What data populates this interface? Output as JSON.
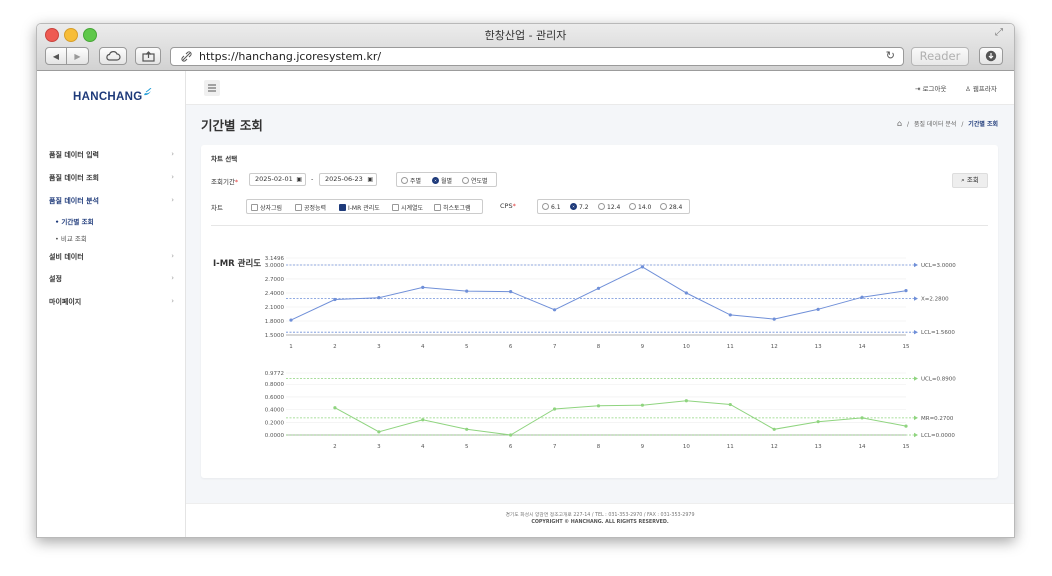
{
  "window": {
    "title": "한창산업 - 관리자"
  },
  "browser": {
    "url": "https://hanchang.jcoresystem.kr/",
    "reader_label": "Reader"
  },
  "sidebar": {
    "logo": "HANCHANG",
    "items": [
      {
        "label": "품질 데이터 입력"
      },
      {
        "label": "품질 데이터 조회"
      },
      {
        "label": "품질 데이터 분석"
      },
      {
        "label": "설비 데이터"
      },
      {
        "label": "설정"
      },
      {
        "label": "마이페이지"
      }
    ],
    "subitems": [
      {
        "label": "• 기간별 조회"
      },
      {
        "label": "• 비교 조회"
      }
    ]
  },
  "topbar": {
    "logout": "로그아웃",
    "user": "웹프라자"
  },
  "page": {
    "title": "기간별 조회",
    "breadcrumb": {
      "sep1": "/",
      "parent": "품질 데이터 분석",
      "sep2": "/",
      "current": "기간별 조회"
    }
  },
  "form": {
    "section_title": "차트 선택",
    "period_label": "조회기간",
    "required_mark": "*",
    "date_from": "2025-02-01",
    "date_sep": "-",
    "date_to": "2025-06-23",
    "period_options": [
      {
        "label": "주별",
        "selected": false
      },
      {
        "label": "월별",
        "selected": true
      },
      {
        "label": "연도별",
        "selected": false
      }
    ],
    "search_label": "조회",
    "chart_label": "차트",
    "chart_options": [
      {
        "label": "상자그림",
        "checked": false
      },
      {
        "label": "공정능력",
        "checked": false
      },
      {
        "label": "I-MR 관리도",
        "checked": true
      },
      {
        "label": "시계열도",
        "checked": false
      },
      {
        "label": "히스토그램",
        "checked": false
      }
    ],
    "cps_label": "CPS",
    "cps_options": [
      {
        "label": "6.1",
        "selected": false
      },
      {
        "label": "7.2",
        "selected": true
      },
      {
        "label": "12.4",
        "selected": false
      },
      {
        "label": "14.0",
        "selected": false
      },
      {
        "label": "28.4",
        "selected": false
      }
    ]
  },
  "footer": {
    "address": "경기도 화성시 양감면 정조고개로 227-14  /  TEL : 031-353-2970  /  FAX : 031-353-2979",
    "copyright": "COPYRIGHT © HANCHANG. ALL RIGHTS RESERVED."
  },
  "colors": {
    "primary": "#1e3a7a",
    "i_chart": "#6f8fd8",
    "mr_chart": "#8fd47f"
  },
  "chart_data": [
    {
      "type": "line",
      "title": "I-MR 관리도",
      "x": [
        1,
        2,
        3,
        4,
        5,
        6,
        7,
        8,
        9,
        10,
        11,
        12,
        13,
        14,
        15
      ],
      "values": [
        1.82,
        2.26,
        2.3,
        2.52,
        2.44,
        2.43,
        2.04,
        2.5,
        2.96,
        2.4,
        1.93,
        1.84,
        2.05,
        2.31,
        2.45
      ],
      "ylim": [
        1.5,
        3.1496
      ],
      "yticks": [
        "1.5000",
        "1.8000",
        "2.1000",
        "2.4000",
        "2.7000",
        "3.0000",
        "3.1496"
      ],
      "reference_lines": [
        {
          "label": "UCL=3.0000",
          "value": 3.0
        },
        {
          "label": "X=2.2800",
          "value": 2.28
        },
        {
          "label": "LCL=1.5600",
          "value": 1.56
        }
      ]
    },
    {
      "type": "line",
      "x": [
        2,
        3,
        4,
        5,
        6,
        7,
        8,
        9,
        10,
        11,
        12,
        13,
        14,
        15
      ],
      "values": [
        0.43,
        0.05,
        0.24,
        0.09,
        0.0,
        0.41,
        0.46,
        0.47,
        0.54,
        0.48,
        0.09,
        0.21,
        0.27,
        0.14
      ],
      "ylim": [
        0,
        0.9772
      ],
      "yticks": [
        "0.0000",
        "0.2000",
        "0.4000",
        "0.6000",
        "0.8000",
        "0.9772"
      ],
      "reference_lines": [
        {
          "label": "UCL=0.8900",
          "value": 0.89
        },
        {
          "label": "MR=0.2700",
          "value": 0.27
        },
        {
          "label": "LCL=0.0000",
          "value": 0.0
        }
      ]
    }
  ]
}
